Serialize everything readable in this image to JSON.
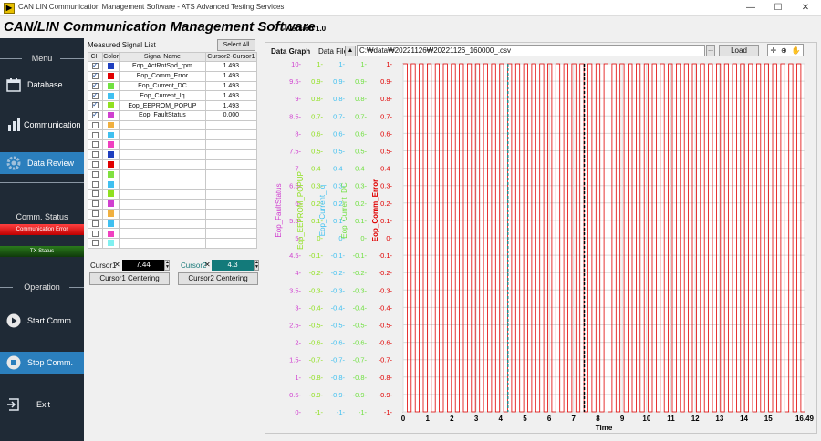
{
  "window": {
    "title": "CAN LIN Communication Management Software  -  ATS Advanced Testing Services",
    "minimize": "—",
    "maximize": "☐",
    "close": "✕"
  },
  "app": {
    "title": "CAN/LIN Communication Management Software",
    "version": "- Version 1.0"
  },
  "sidebar": {
    "menu_label": "Menu",
    "items": [
      {
        "label": "Database",
        "icon": "calendar-icon"
      },
      {
        "label": "Communication",
        "icon": "bar-chart-icon"
      },
      {
        "label": "Data Review",
        "icon": "gear-icon",
        "active": true
      }
    ],
    "comm_status_label": "Comm. Status",
    "status_bars": [
      {
        "label": "Communication Error",
        "color": "#e00000"
      },
      {
        "label": "TX Status",
        "color": "#1a5a12"
      }
    ],
    "operation_label": "Operation",
    "operation_items": [
      {
        "label": "Start Comm.",
        "icon": "play-icon"
      },
      {
        "label": "Stop Comm.",
        "icon": "stop-icon",
        "active": true
      },
      {
        "label": "Exit",
        "icon": "exit-icon"
      }
    ]
  },
  "signal_list": {
    "title": "Measured Signal List",
    "select_all": "Select All",
    "headers": [
      "CH",
      "Color",
      "Signal Name",
      "Cursor2-Cursor1"
    ],
    "rows": [
      {
        "checked": true,
        "color": "#1f3fbf",
        "name": "Eop_ActRotSpd_rpm",
        "value": "1.493"
      },
      {
        "checked": true,
        "color": "#e00000",
        "name": "Eop_Comm_Error",
        "value": "1.493"
      },
      {
        "checked": true,
        "color": "#70e040",
        "name": "Eop_Current_DC",
        "value": "1.493"
      },
      {
        "checked": true,
        "color": "#40c0f0",
        "name": "Eop_Current_Iq",
        "value": "1.493"
      },
      {
        "checked": true,
        "color": "#90e020",
        "name": "Eop_EEPROM_POPUP",
        "value": "1.493"
      },
      {
        "checked": true,
        "color": "#d040d0",
        "name": "Eop_FaultStatus",
        "value": "0.000"
      },
      {
        "checked": false,
        "color": "#f0b040",
        "name": "",
        "value": ""
      },
      {
        "checked": false,
        "color": "#40c0f0",
        "name": "",
        "value": ""
      },
      {
        "checked": false,
        "color": "#f040c0",
        "name": "",
        "value": ""
      },
      {
        "checked": false,
        "color": "#1f3fbf",
        "name": "",
        "value": ""
      },
      {
        "checked": false,
        "color": "#e00000",
        "name": "",
        "value": ""
      },
      {
        "checked": false,
        "color": "#80e040",
        "name": "",
        "value": ""
      },
      {
        "checked": false,
        "color": "#40c0f0",
        "name": "",
        "value": ""
      },
      {
        "checked": false,
        "color": "#90e020",
        "name": "",
        "value": ""
      },
      {
        "checked": false,
        "color": "#d040d0",
        "name": "",
        "value": ""
      },
      {
        "checked": false,
        "color": "#f0b040",
        "name": "",
        "value": ""
      },
      {
        "checked": false,
        "color": "#40c0f0",
        "name": "",
        "value": ""
      },
      {
        "checked": false,
        "color": "#f040c0",
        "name": "",
        "value": ""
      },
      {
        "checked": false,
        "color": "#80f0f0",
        "name": "",
        "value": ""
      }
    ]
  },
  "cursors": {
    "cursor1_label": "Cursor1",
    "cursor1_value": "7.44",
    "cursor2_label": "Cursor2",
    "cursor2_value": "4.3",
    "cursor1_centering": "Cursor1 Centering",
    "cursor2_centering": "Cursor2 Centering"
  },
  "graph_header": {
    "label": "Data Graph",
    "file_label": "Data File",
    "file_path": "C:₩data₩20221126₩20221126_160000_.csv",
    "load": "Load",
    "browse": "..."
  },
  "chart_data": {
    "type": "line",
    "xlabel": "Time",
    "xlim": [
      0,
      16.49
    ],
    "x_ticks": [
      "0",
      "1",
      "2",
      "3",
      "4",
      "5",
      "6",
      "7",
      "8",
      "9",
      "10",
      "11",
      "12",
      "13",
      "14",
      "15",
      "16.49"
    ],
    "grid": true,
    "axes": [
      {
        "name": "Eop_FaultStatus",
        "color": "#d040d0",
        "ticks": [
          "10",
          "9.5",
          "9",
          "8.5",
          "8",
          "7.5",
          "7",
          "6.5",
          "6",
          "5.5",
          "5",
          "4.5",
          "4",
          "3.5",
          "3",
          "2.5",
          "2",
          "1.5",
          "1",
          "0.5",
          "0"
        ]
      },
      {
        "name": "Eop_EEPROM_POPUP",
        "color": "#90e020",
        "ticks": [
          "1",
          "0.9",
          "0.8",
          "0.7",
          "0.6",
          "0.5",
          "0.4",
          "0.3",
          "0.2",
          "0.1",
          "0",
          "-0.1",
          "-0.2",
          "-0.3",
          "-0.4",
          "-0.5",
          "-0.6",
          "-0.7",
          "-0.8",
          "-0.9",
          "-1"
        ]
      },
      {
        "name": "Eop_Current_Iq",
        "color": "#40c0f0",
        "ticks": [
          "1",
          "0.9",
          "0.8",
          "0.7",
          "0.6",
          "0.5",
          "0.4",
          "0.3",
          "0.2",
          "0.1",
          "0",
          "-0.1",
          "-0.2",
          "-0.3",
          "-0.4",
          "-0.5",
          "-0.6",
          "-0.7",
          "-0.8",
          "-0.9",
          "-1"
        ]
      },
      {
        "name": "Eop_Current_DC",
        "color": "#70e040",
        "ticks": [
          "1",
          "0.9",
          "0.8",
          "0.7",
          "0.6",
          "0.5",
          "0.4",
          "0.3",
          "0.2",
          "0.1",
          "0",
          "-0.1",
          "-0.2",
          "-0.3",
          "-0.4",
          "-0.5",
          "-0.6",
          "-0.7",
          "-0.8",
          "-0.9",
          "-1"
        ]
      },
      {
        "name": "Eop_Comm_Error",
        "color": "#e00000",
        "ticks": [
          "1",
          "0.9",
          "0.8",
          "0.7",
          "0.6",
          "0.5",
          "0.4",
          "0.3",
          "0.2",
          "0.1",
          "0",
          "-0.1",
          "-0.2",
          "-0.3",
          "-0.4",
          "-0.5",
          "-0.6",
          "-0.7",
          "-0.8",
          "-0.9",
          "-1"
        ]
      }
    ],
    "series": [
      {
        "name": "Eop_Comm_Error",
        "color": "#e00000",
        "pattern": "square-wave",
        "period": 0.33,
        "ymin": -1,
        "ymax": 1
      }
    ],
    "cursors": [
      {
        "x": 4.3,
        "color": "#2a8a8a"
      },
      {
        "x": 7.44,
        "color": "#000000"
      }
    ]
  }
}
